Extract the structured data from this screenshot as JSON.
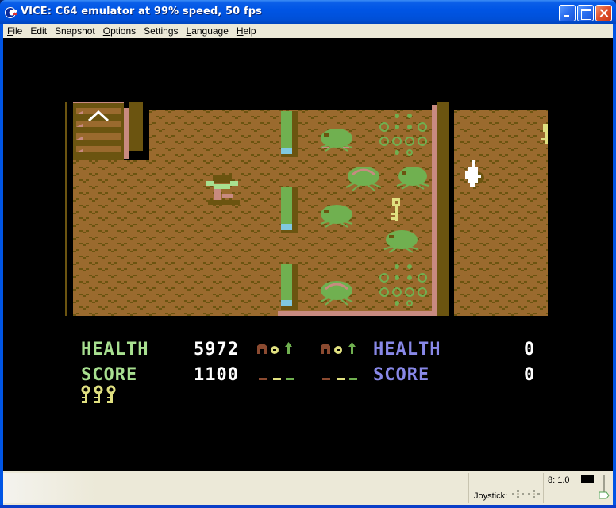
{
  "window": {
    "title": "VICE: C64 emulator at 99% speed, 50 fps",
    "app_icon": "commodore-logo-icon",
    "controls": {
      "minimize": "minimize-icon",
      "maximize": "maximize-icon",
      "close": "close-icon"
    }
  },
  "menubar": {
    "items": [
      {
        "label": "File",
        "accel": "F",
        "rest": "ile"
      },
      {
        "label": "Edit",
        "accel": "",
        "rest": "Edit"
      },
      {
        "label": "Snapshot",
        "accel": "",
        "rest": "Snapshot"
      },
      {
        "label": "Options",
        "accel": "O",
        "rest": "ptions"
      },
      {
        "label": "Settings",
        "accel": "",
        "rest": "Settings"
      },
      {
        "label": "Language",
        "accel": "L",
        "rest": "anguage"
      },
      {
        "label": "Help",
        "accel": "H",
        "rest": "elp"
      }
    ]
  },
  "game": {
    "colors": {
      "floor": "#9a6a2e",
      "floor_dark": "#6b5410",
      "wall_dark": "#6b5410",
      "wall_pink": "#c88a80",
      "green": "#70b050",
      "light_green": "#a8e090",
      "light_blue": "#80c8e0",
      "yellow": "#e0e080",
      "white": "#ffffff",
      "purple": "#8888e8",
      "brown_red": "#8b4a30"
    },
    "hud": {
      "player1": {
        "health_label": "HEALTH",
        "health_value": "5972",
        "score_label": "SCORE",
        "score_value": "1100",
        "keys": 3
      },
      "player2": {
        "health_label": "HEALTH",
        "health_value": "0",
        "score_label": "SCORE",
        "score_value": "0"
      },
      "inventory_slots": [
        "armor-icon",
        "potion-icon",
        "arrow-up-icon"
      ]
    },
    "sprites": {
      "hero": "warrior-hero",
      "enemies": [
        "green-spider",
        "green-spider",
        "green-spider",
        "green-spider",
        "green-spider",
        "green-spider"
      ],
      "pickups": [
        "key",
        "key"
      ],
      "generators": [
        "spawner-bubbles",
        "spawner-bubbles"
      ],
      "other": "white-ghost"
    }
  },
  "statusbar": {
    "joystick_label": "Joystick:",
    "speed_readout": "8: 1.0"
  }
}
